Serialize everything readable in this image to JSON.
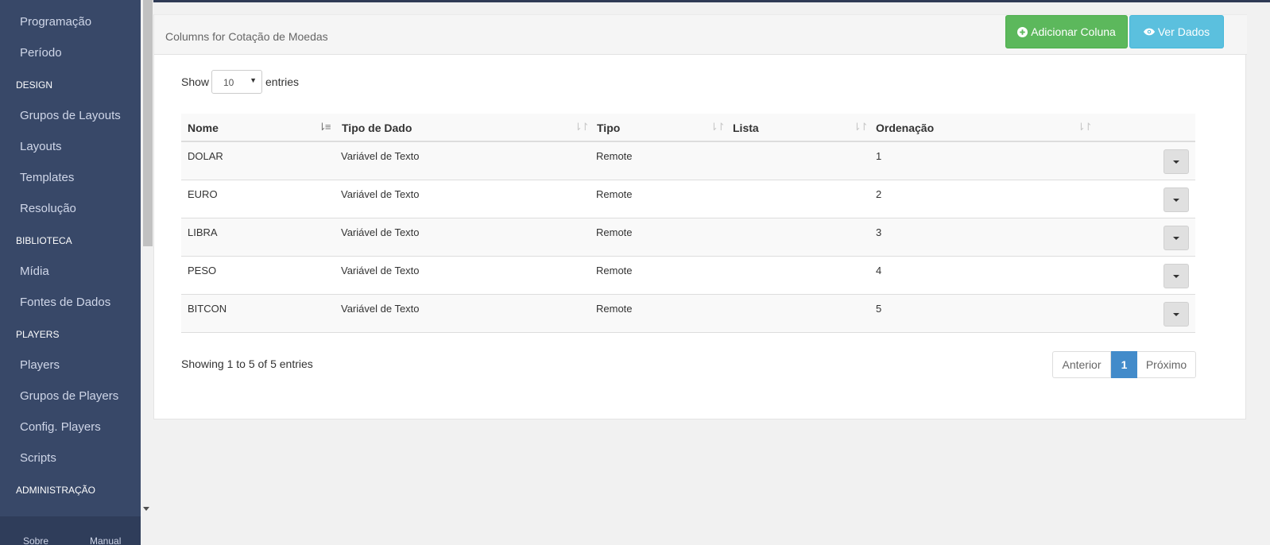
{
  "sidebar": {
    "items": [
      {
        "type": "item",
        "label": "Programação",
        "name": "sidebar-item-programacao"
      },
      {
        "type": "item",
        "label": "Período",
        "name": "sidebar-item-periodo"
      },
      {
        "type": "header",
        "label": "DESIGN",
        "name": "sidebar-header-design"
      },
      {
        "type": "item",
        "label": "Grupos de Layouts",
        "name": "sidebar-item-grupos-layouts"
      },
      {
        "type": "item",
        "label": "Layouts",
        "name": "sidebar-item-layouts"
      },
      {
        "type": "item",
        "label": "Templates",
        "name": "sidebar-item-templates"
      },
      {
        "type": "item",
        "label": "Resolução",
        "name": "sidebar-item-resolucao"
      },
      {
        "type": "header",
        "label": "BIBLIOTECA",
        "name": "sidebar-header-biblioteca"
      },
      {
        "type": "item",
        "label": "Mídia",
        "name": "sidebar-item-midia"
      },
      {
        "type": "item",
        "label": "Fontes de Dados",
        "name": "sidebar-item-fontes-dados"
      },
      {
        "type": "header",
        "label": "PLAYERS",
        "name": "sidebar-header-players"
      },
      {
        "type": "item",
        "label": "Players",
        "name": "sidebar-item-players"
      },
      {
        "type": "item",
        "label": "Grupos de Players",
        "name": "sidebar-item-grupos-players"
      },
      {
        "type": "item",
        "label": "Config. Players",
        "name": "sidebar-item-config-players"
      },
      {
        "type": "item",
        "label": "Scripts",
        "name": "sidebar-item-scripts"
      },
      {
        "type": "header",
        "label": "ADMINISTRAÇÃO",
        "name": "sidebar-header-administracao"
      }
    ],
    "footer": {
      "about": "Sobre",
      "manual": "Manual"
    }
  },
  "panel": {
    "title": "Columns for Cotação de Moedas",
    "add_button": "Adicionar Coluna",
    "view_button": "Ver Dados"
  },
  "length": {
    "show": "Show",
    "value": "10",
    "entries": "entries"
  },
  "table": {
    "headers": [
      "Nome",
      "Tipo de Dado",
      "Tipo",
      "Lista",
      "Ordenação"
    ],
    "rows": [
      [
        "DOLAR",
        "Variável de Texto",
        "Remote",
        "",
        "1"
      ],
      [
        "EURO",
        "Variável de Texto",
        "Remote",
        "",
        "2"
      ],
      [
        "LIBRA",
        "Variável de Texto",
        "Remote",
        "",
        "3"
      ],
      [
        "PESO",
        "Variável de Texto",
        "Remote",
        "",
        "4"
      ],
      [
        "BITCON",
        "Variável de Texto",
        "Remote",
        "",
        "5"
      ]
    ]
  },
  "info": "Showing 1 to 5 of 5 entries",
  "pagination": {
    "previous": "Anterior",
    "current": "1",
    "next": "Próximo"
  },
  "colors": {
    "sidebar": "#384868",
    "success": "#5cb85c",
    "info": "#5bc0de",
    "primary": "#428bca"
  }
}
